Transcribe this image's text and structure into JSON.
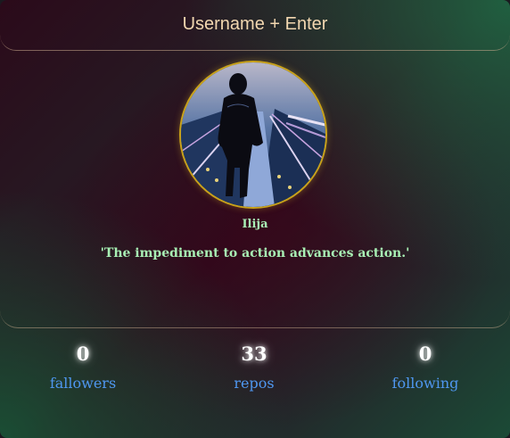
{
  "header": {
    "title": "Username + Enter"
  },
  "profile": {
    "avatar_icon": "user-avatar-photo",
    "name": "Ilija",
    "quote": "'The impediment to action advances action.'"
  },
  "stats": [
    {
      "value": "0",
      "label": "fallowers"
    },
    {
      "value": "33",
      "label": "repos"
    },
    {
      "value": "0",
      "label": "following"
    }
  ],
  "colors": {
    "title": "#f2d7b0",
    "name_and_quote": "#a8f0b4",
    "stat_label": "#4f97f0",
    "avatar_border": "#c9a21a"
  }
}
